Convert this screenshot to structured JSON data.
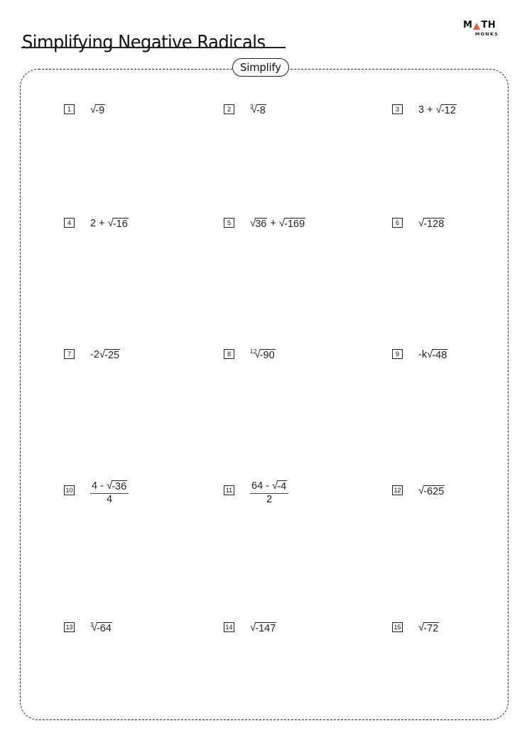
{
  "header": {
    "title": "Simplifying Negative Radicals",
    "logo": {
      "top_left": "M",
      "top_right": "TH",
      "bottom": "MONKS",
      "accent_color": "#e8603c"
    }
  },
  "section": {
    "label": "Simplify"
  },
  "problems": [
    {
      "number": "1",
      "parts": [
        {
          "type": "rad",
          "index": "",
          "radicand": "-9"
        }
      ]
    },
    {
      "number": "2",
      "parts": [
        {
          "type": "rad",
          "index": "3",
          "radicand": "-8"
        }
      ]
    },
    {
      "number": "3",
      "parts": [
        {
          "type": "text",
          "value": "3 + "
        },
        {
          "type": "rad",
          "index": "",
          "radicand": "-12"
        }
      ]
    },
    {
      "number": "4",
      "parts": [
        {
          "type": "text",
          "value": "2 + "
        },
        {
          "type": "rad",
          "index": "",
          "radicand": "-16"
        }
      ]
    },
    {
      "number": "5",
      "parts": [
        {
          "type": "rad",
          "index": "",
          "radicand": "36"
        },
        {
          "type": "text",
          "value": " + "
        },
        {
          "type": "rad",
          "index": "",
          "radicand": "-169"
        }
      ]
    },
    {
      "number": "6",
      "parts": [
        {
          "type": "rad",
          "index": "",
          "radicand": "-128"
        }
      ]
    },
    {
      "number": "7",
      "parts": [
        {
          "type": "text",
          "value": "-2"
        },
        {
          "type": "rad",
          "index": "",
          "radicand": "-25"
        }
      ]
    },
    {
      "number": "8",
      "parts": [
        {
          "type": "rad",
          "index": "12",
          "radicand": "-90"
        }
      ]
    },
    {
      "number": "9",
      "parts": [
        {
          "type": "text",
          "value": "-k"
        },
        {
          "type": "rad",
          "index": "",
          "radicand": "-48"
        }
      ]
    },
    {
      "number": "10",
      "parts": [
        {
          "type": "frac",
          "numerator": [
            {
              "type": "text",
              "value": "4 - "
            },
            {
              "type": "rad",
              "index": "",
              "radicand": "-36"
            }
          ],
          "denominator": "4"
        }
      ]
    },
    {
      "number": "11",
      "parts": [
        {
          "type": "frac",
          "numerator": [
            {
              "type": "text",
              "value": "64 - "
            },
            {
              "type": "rad",
              "index": "",
              "radicand": "-4"
            }
          ],
          "denominator": "2"
        }
      ]
    },
    {
      "number": "12",
      "parts": [
        {
          "type": "rad",
          "index": "",
          "radicand": "-625"
        }
      ]
    },
    {
      "number": "13",
      "parts": [
        {
          "type": "rad",
          "index": "3",
          "radicand": "-64"
        }
      ]
    },
    {
      "number": "14",
      "parts": [
        {
          "type": "rad",
          "index": "",
          "radicand": "-147"
        }
      ]
    },
    {
      "number": "15",
      "parts": [
        {
          "type": "rad",
          "index": "",
          "radicand": "-72"
        }
      ]
    }
  ]
}
